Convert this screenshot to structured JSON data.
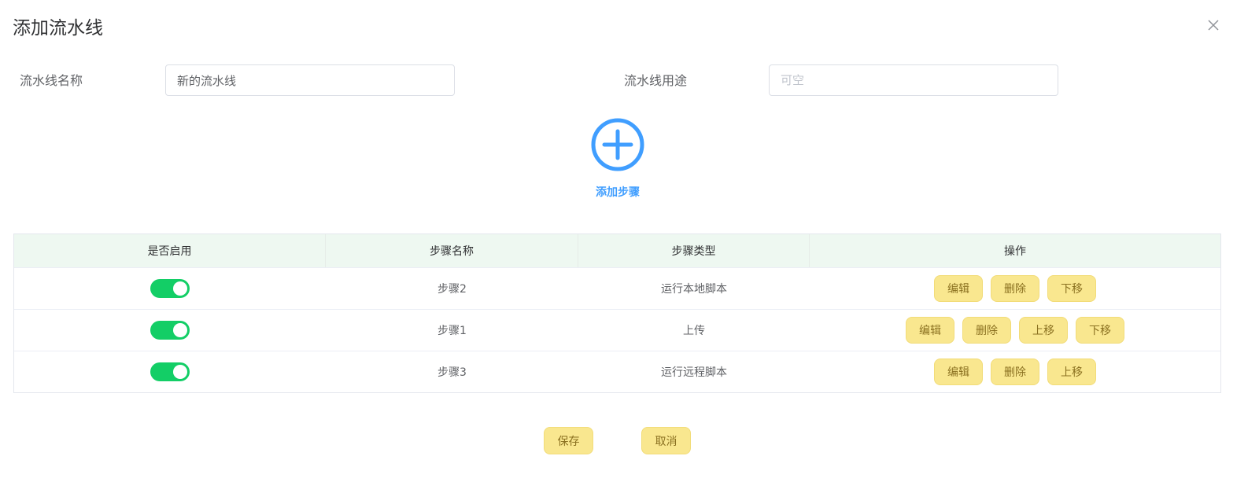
{
  "dialog": {
    "title": "添加流水线"
  },
  "form": {
    "name_label": "流水线名称",
    "name_value": "新的流水线",
    "purpose_label": "流水线用途",
    "purpose_placeholder": "可空"
  },
  "add_step": {
    "label": "添加步骤",
    "icon": "plus-circle-icon",
    "color": "#409eff"
  },
  "table": {
    "columns": [
      "是否启用",
      "步骤名称",
      "步骤类型",
      "操作"
    ],
    "rows": [
      {
        "enabled": true,
        "name": "步骤2",
        "type": "运行本地脚本",
        "actions": [
          "编辑",
          "删除",
          "下移"
        ]
      },
      {
        "enabled": true,
        "name": "步骤1",
        "type": "上传",
        "actions": [
          "编辑",
          "删除",
          "上移",
          "下移"
        ]
      },
      {
        "enabled": true,
        "name": "步骤3",
        "type": "运行远程脚本",
        "actions": [
          "编辑",
          "删除",
          "上移"
        ]
      }
    ]
  },
  "footer": {
    "save_label": "保存",
    "cancel_label": "取消"
  },
  "colors": {
    "switch_on": "#13ce66",
    "action_button": "#f9e78f",
    "table_header_bg": "#eef8f1"
  }
}
